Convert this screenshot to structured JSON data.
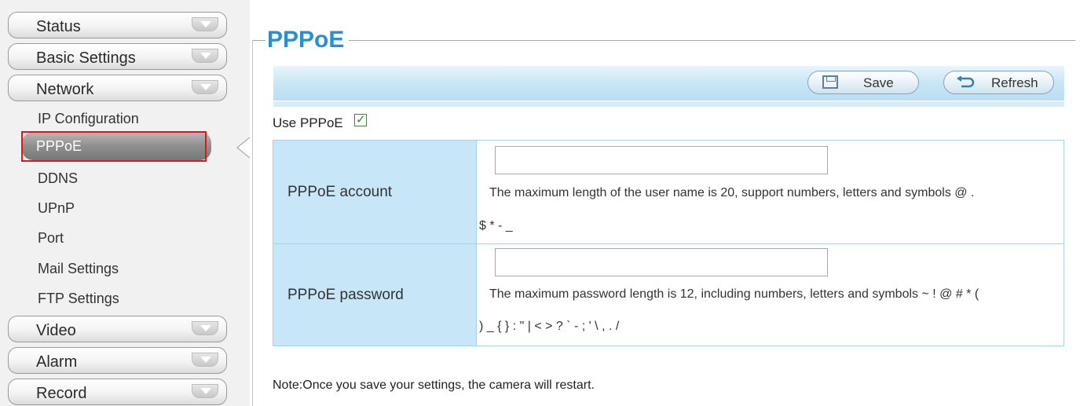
{
  "sidebar": {
    "menus": [
      {
        "label": "Status"
      },
      {
        "label": "Basic Settings"
      },
      {
        "label": "Network"
      },
      {
        "label": "Video"
      },
      {
        "label": "Alarm"
      },
      {
        "label": "Record"
      }
    ],
    "network_sub": [
      {
        "label": "IP Configuration"
      },
      {
        "label": "PPPoE"
      },
      {
        "label": "DDNS"
      },
      {
        "label": "UPnP"
      },
      {
        "label": "Port"
      },
      {
        "label": "Mail Settings"
      },
      {
        "label": "FTP Settings"
      }
    ],
    "active_item": "PPPoE"
  },
  "main": {
    "title": "PPPoE",
    "toolbar": {
      "save_label": "Save",
      "refresh_label": "Refresh"
    },
    "use_pppoe": {
      "label": "Use PPPoE",
      "checked": true
    },
    "account": {
      "label": "PPPoE account",
      "value": "",
      "hint_line1": "The maximum length of the user name is 20, support numbers, letters and symbols @ .",
      "hint_line2": "$ * - _"
    },
    "password": {
      "label": "PPPoE password",
      "value": "",
      "hint_line1": "The maximum password length is 12, including numbers, letters and symbols ~ ! @ # * (",
      "hint_line2": ") _ { } : \" | < > ? ` - ; ' \\ , . /"
    },
    "note": "Note:Once you save your settings, the camera will restart."
  },
  "colors": {
    "accent": "#2a8fd0",
    "toolbar": "#c7e5f5",
    "label_cell": "#c7e6f7",
    "highlight": "#e0161b"
  }
}
